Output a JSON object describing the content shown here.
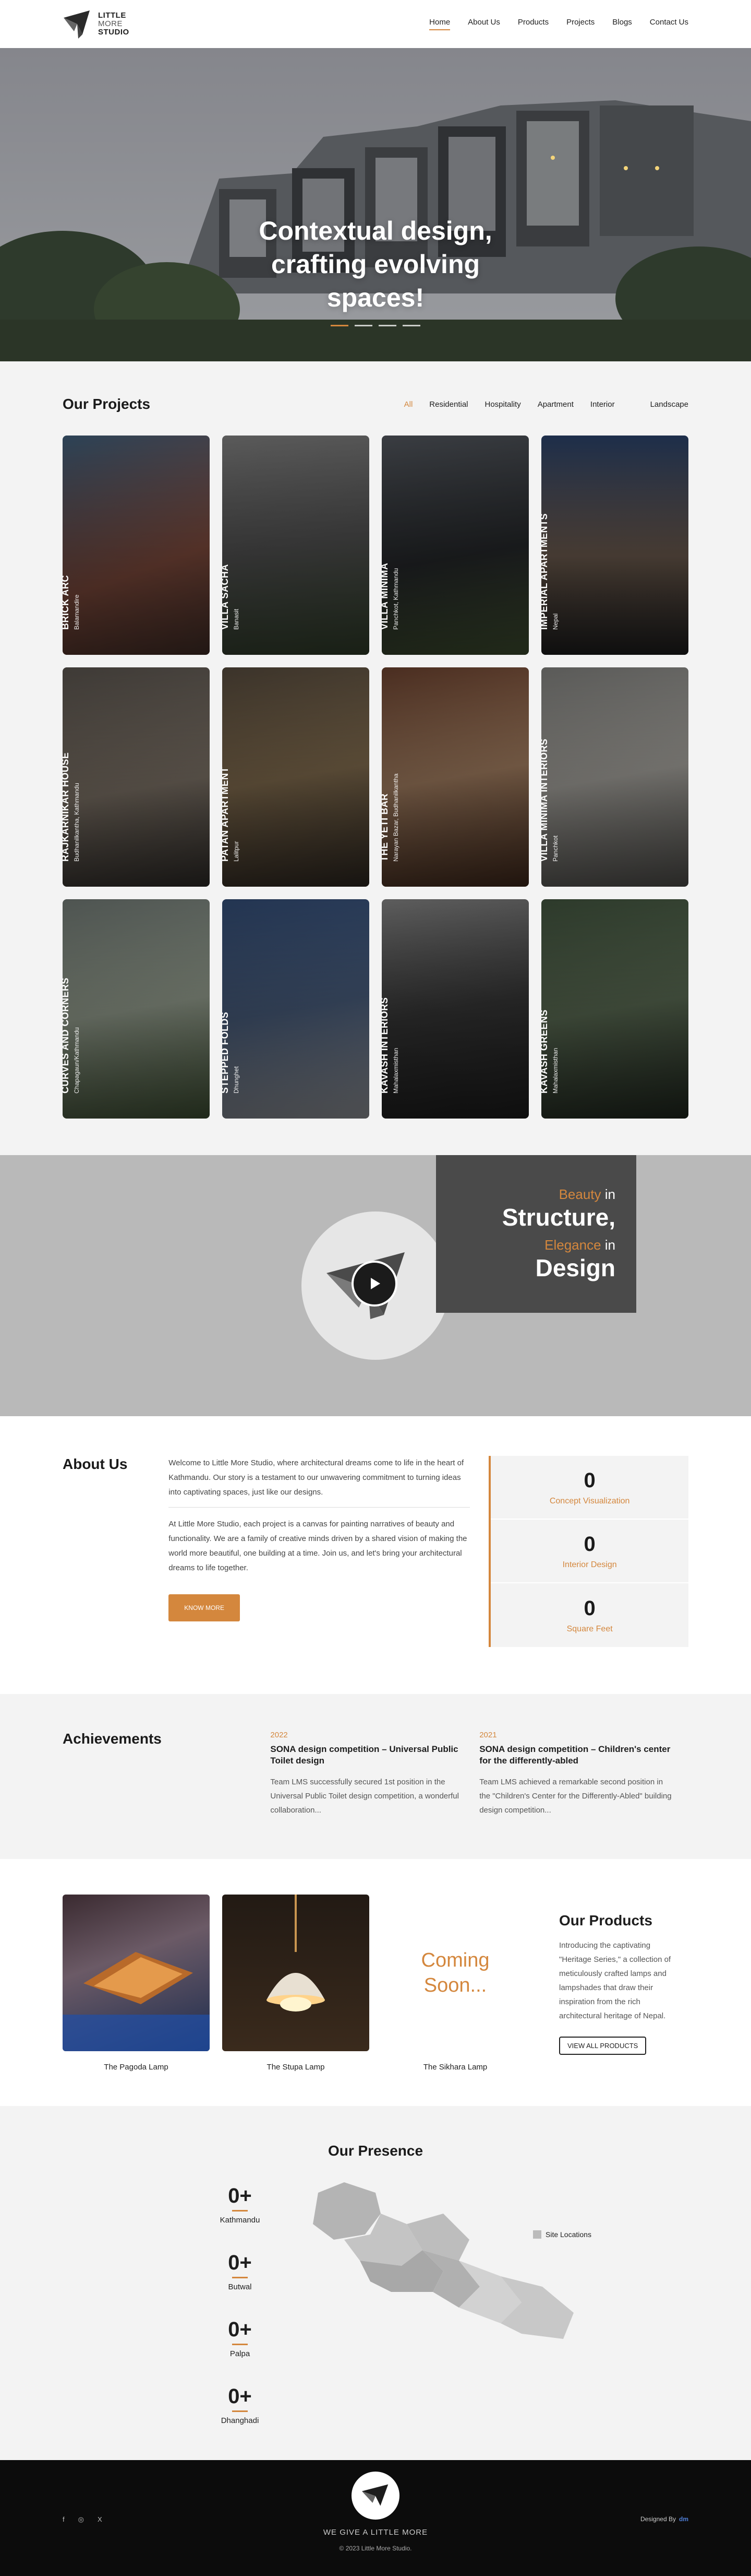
{
  "brand": {
    "line1": "LITTLE",
    "line2": "MORE",
    "line3": "STUDIO"
  },
  "nav": {
    "items": [
      {
        "label": "Home",
        "active": true
      },
      {
        "label": "About Us"
      },
      {
        "label": "Products"
      },
      {
        "label": "Projects"
      },
      {
        "label": "Blogs"
      },
      {
        "label": "Contact Us"
      }
    ]
  },
  "hero": {
    "title_lines": [
      "Contextual design,",
      "crafting evolving",
      "spaces!"
    ],
    "dots": 4
  },
  "projects": {
    "title": "Our Projects",
    "filters": [
      "All",
      "Residential",
      "Hospitality",
      "Apartment",
      "Interior",
      "Landscape"
    ],
    "active_filter": "All",
    "cards": [
      {
        "name": "BRICK ARC",
        "location": "Balamandire"
      },
      {
        "name": "VILLA SACHA",
        "location": "Banasit"
      },
      {
        "name": "VILLA MINIMA",
        "location": "Panchkot, Kathmandu"
      },
      {
        "name": "IMPERIAL APARTMENTS",
        "location": "Nepal"
      },
      {
        "name": "RAJKARNIKAR HOUSE",
        "location": "Budhanilkantha, Kathmandu"
      },
      {
        "name": "PATAN APARTMENT",
        "location": "Lalitpur"
      },
      {
        "name": "THE YETI BAR",
        "location": "Narayan Bazar, Budhanilkantha"
      },
      {
        "name": "VILLA MINIMA INTERIORS",
        "location": "Panchkot"
      },
      {
        "name": "CURVES AND CORNERS",
        "location": "Chapagaun/Kathmandu"
      },
      {
        "name": "STEPPED FOLDS",
        "location": "Dhunghet"
      },
      {
        "name": "KAVASH INTERIORS",
        "location": "Mahalaxmisthan"
      },
      {
        "name": "KAVASH GREENS",
        "location": "Mahalaxmisthan"
      }
    ]
  },
  "video_banner": {
    "line1_accent": "Beauty",
    "line1_rest": " in",
    "line2": "Structure,",
    "line3_accent": "Elegance",
    "line3_rest": " in",
    "line4": "Design"
  },
  "about": {
    "title": "About Us",
    "para1": "Welcome to Little More Studio, where architectural dreams come to life in the heart of Kathmandu. Our story is a testament to our unwavering commitment to turning ideas into captivating spaces, just like our designs.",
    "para2": "At Little More Studio, each project is a canvas for painting narratives of beauty and functionality. We are a family of creative minds driven by a shared vision of making the world more beautiful, one building at a time. Join us, and let's bring your architectural dreams to life together.",
    "button": "KNOW MORE",
    "stats": [
      {
        "value": "0",
        "label": "Concept Visualization"
      },
      {
        "value": "0",
        "label": "Interior Design"
      },
      {
        "value": "0",
        "label": "Square Feet"
      }
    ]
  },
  "achievements": {
    "title": "Achievements",
    "items": [
      {
        "year": "2022",
        "title": "SONA design competition – Universal Public Toilet design",
        "desc": "Team LMS successfully secured 1st position in the Universal Public Toilet design competition, a wonderful collaboration..."
      },
      {
        "year": "2021",
        "title": "SONA design competition – Children's center for the differently-abled",
        "desc": "Team LMS achieved a remarkable second position in the \"Children's Center for the Differently-Abled\" building design competition..."
      }
    ]
  },
  "products": {
    "items": [
      {
        "caption": "The Pagoda Lamp"
      },
      {
        "caption": "The Stupa Lamp"
      },
      {
        "caption": "The Sikhara Lamp",
        "coming_soon": "Coming Soon..."
      }
    ],
    "title": "Our Products",
    "desc": "Introducing the captivating \"Heritage Series,\" a collection of meticulously crafted lamps and lampshades that draw their inspiration from the rich architectural heritage of Nepal.",
    "button": "VIEW ALL PRODUCTS"
  },
  "presence": {
    "title": "Our Presence",
    "sites": [
      {
        "value": "0+",
        "name": "Kathmandu"
      },
      {
        "value": "0+",
        "name": "Butwal"
      },
      {
        "value": "0+",
        "name": "Palpa"
      },
      {
        "value": "0+",
        "name": "Dhanghadi"
      }
    ],
    "legend": "Site Locations"
  },
  "footer": {
    "social": [
      "f",
      "◎",
      "X"
    ],
    "tagline": "WE GIVE A LITTLE MORE",
    "copyright": "© 2023 Little More Studio.",
    "designed_by": "Designed By",
    "designer_mark": "dm"
  },
  "colors": {
    "accent": "#d4873d",
    "dark": "#1e1e1e",
    "light_bg": "#f3f3f3"
  }
}
